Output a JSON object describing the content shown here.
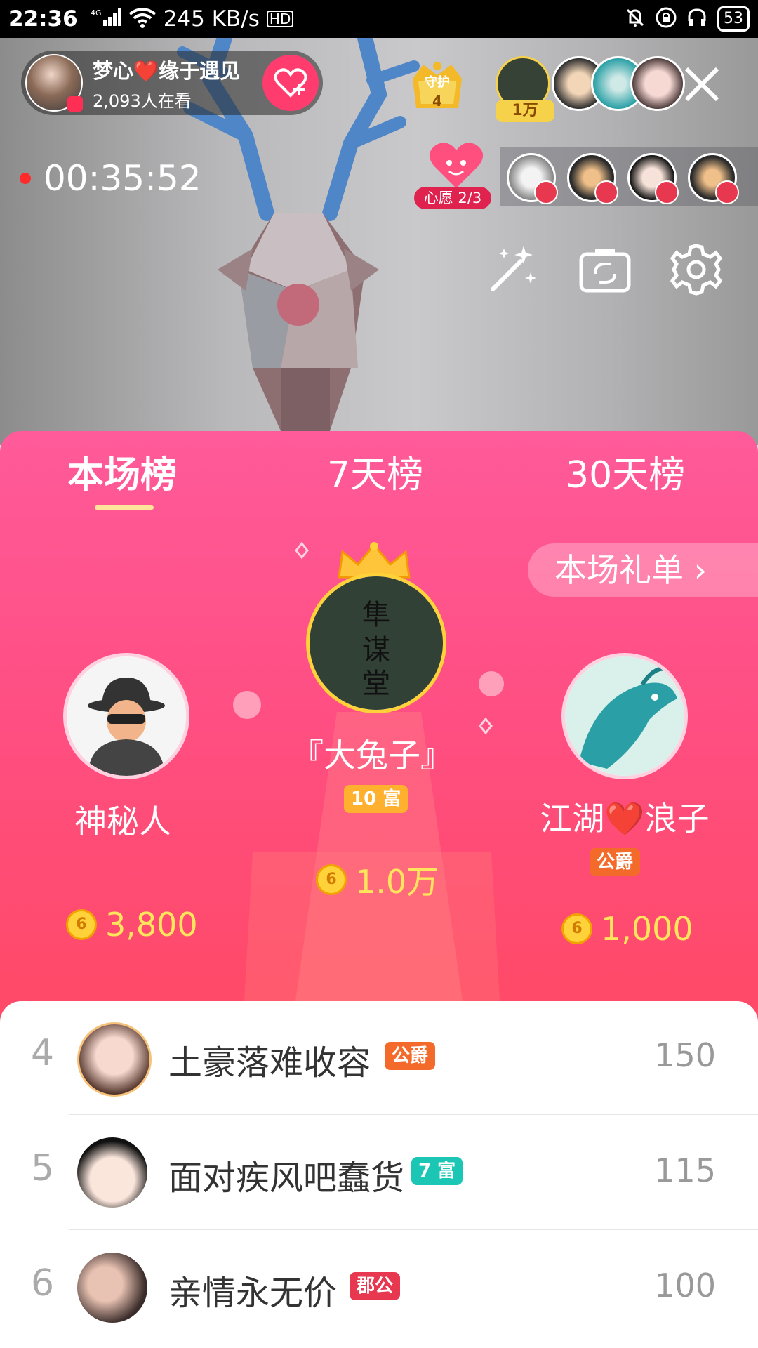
{
  "status_bar": {
    "time": "22:36",
    "network": "4G",
    "speed": "245 KB/s",
    "hd": "HD",
    "battery": "53"
  },
  "live": {
    "anchor_name": "梦心❤️缘于遇见",
    "viewers": "2,093人在看",
    "guard_label": "守护",
    "guard_count": "4",
    "top_viewer_tag": "1万",
    "timer": "00:35:52",
    "wish_label": "心愿 2/3"
  },
  "tabs": [
    {
      "label": "本场榜"
    },
    {
      "label": "7天榜"
    },
    {
      "label": "30天榜"
    }
  ],
  "gift_list_button": "本场礼单 ›",
  "podium": {
    "first": {
      "name": "『大兔子』",
      "badge": "10 富",
      "coins": "1.0万"
    },
    "second": {
      "name": "神秘人",
      "coins": "3,800"
    },
    "third": {
      "name": "江湖❤️浪子",
      "badge": "公爵",
      "coins": "1,000"
    }
  },
  "ranking": [
    {
      "rank": "4",
      "name": "土豪落难收容",
      "badge": "公爵",
      "score": "150"
    },
    {
      "rank": "5",
      "name": "面对疾风吧蠢货",
      "badge": "7 富",
      "score": "115"
    },
    {
      "rank": "6",
      "name": "亲情永无价",
      "badge": "郡公",
      "score": "100"
    }
  ],
  "colors": {
    "panel_top": "#ff5a9a",
    "panel_bottom": "#ff4e57",
    "coin_text": "#ffe55c",
    "active_underline": "#ffe39a",
    "badge_teal": "#1cc6b5",
    "badge_orange": "#f46a2b"
  },
  "icons": [
    "signal-icon",
    "wifi-icon",
    "bell-off-icon",
    "lock-icon",
    "headphones-icon",
    "battery-icon",
    "heart-plus-icon",
    "crown-icon",
    "close-icon",
    "record-dot-icon",
    "magic-wand-icon",
    "flip-camera-icon",
    "settings-gear-icon",
    "coin-icon",
    "chevron-right-icon"
  ]
}
